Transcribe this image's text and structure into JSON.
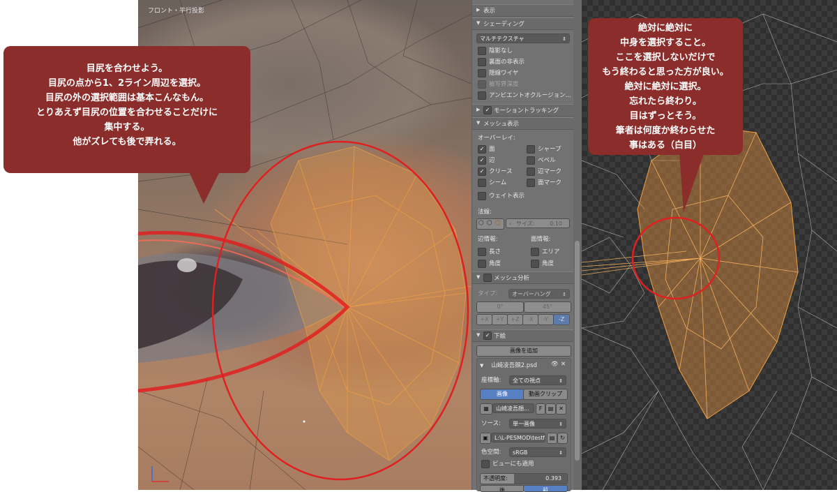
{
  "viewport_left": {
    "label": "フロント・平行投影"
  },
  "panel": {
    "display_header": "表示",
    "shading": {
      "header": "シェーディング",
      "mode": "マルチテクスチャ",
      "options": [
        "陰影なし",
        "裏面の非表示",
        "隠線ワイヤ",
        "被写界深度",
        "アンビエントオクルージョン..."
      ]
    },
    "motion_tracking": {
      "header": "モーショントラッキング"
    },
    "mesh_display": {
      "header": "メッシュ表示",
      "overlay_label": "オーバーレイ:",
      "overlay_left": [
        "面",
        "辺",
        "クリース",
        "シーム"
      ],
      "overlay_right": [
        "シャープ",
        "ベベル",
        "辺マーク",
        "面マーク"
      ],
      "weight": "ウェイト表示",
      "normals_label": "法線:",
      "size_label": "サイズ:",
      "size_value": "0.10",
      "edge_info_label": "辺情報:",
      "face_info_label": "面情報:",
      "edge_info": [
        "長さ",
        "角度"
      ],
      "face_info": [
        "エリア",
        "角度"
      ]
    },
    "mesh_analysis": {
      "header": "メッシュ分析",
      "type_label": "タイプ:",
      "type_value": "オーバーハング",
      "min": "0°",
      "max": "45°",
      "axes": [
        "+X",
        "+Y",
        "+Z",
        "-X",
        "-Y",
        "-Z"
      ]
    },
    "background": {
      "header": "下絵",
      "add_image": "画像を追加",
      "image_name": "山崎凌吾顔2.psd",
      "axis_label": "座標軸:",
      "axis_value": "全ての視点",
      "tab_image": "画像",
      "tab_clip": "動画クリップ",
      "file_short": "山崎凌吾顔...",
      "f_label": "F",
      "source_label": "ソース:",
      "source_value": "単一画像",
      "path": "L:\\L-PESMOD\\testf...",
      "colorspace_label": "色空間:",
      "colorspace_value": "sRGB",
      "view_apply": "ビューにも適用",
      "opacity_label": "不透明度:",
      "opacity_value": "0.393",
      "back": "後",
      "front": "前"
    }
  },
  "callout_left": {
    "lines": [
      "目尻を合わせよう。",
      "目尻の点から1、2ライン周辺を選択。",
      "目尻の外の選択範囲は基本こんなもん。",
      "とりあえず目尻の位置を合わせることだけに",
      "集中する。",
      "他がズレても後で弄れる。"
    ]
  },
  "callout_right": {
    "lines": [
      "絶対に絶対に",
      "中身を選択すること。",
      "ここを選択しないだけで",
      "もう終わると思った方が良い。",
      "絶対に絶対に選択。",
      "忘れたら終わり。",
      "目はずっとそう。",
      "筆者は何度か終わらせた",
      "事はある（白目）"
    ]
  },
  "colors": {
    "callout": "#8b2e2b",
    "selection": "#f0a040",
    "highlight_ring": "#e02020",
    "panel": "#727272"
  }
}
